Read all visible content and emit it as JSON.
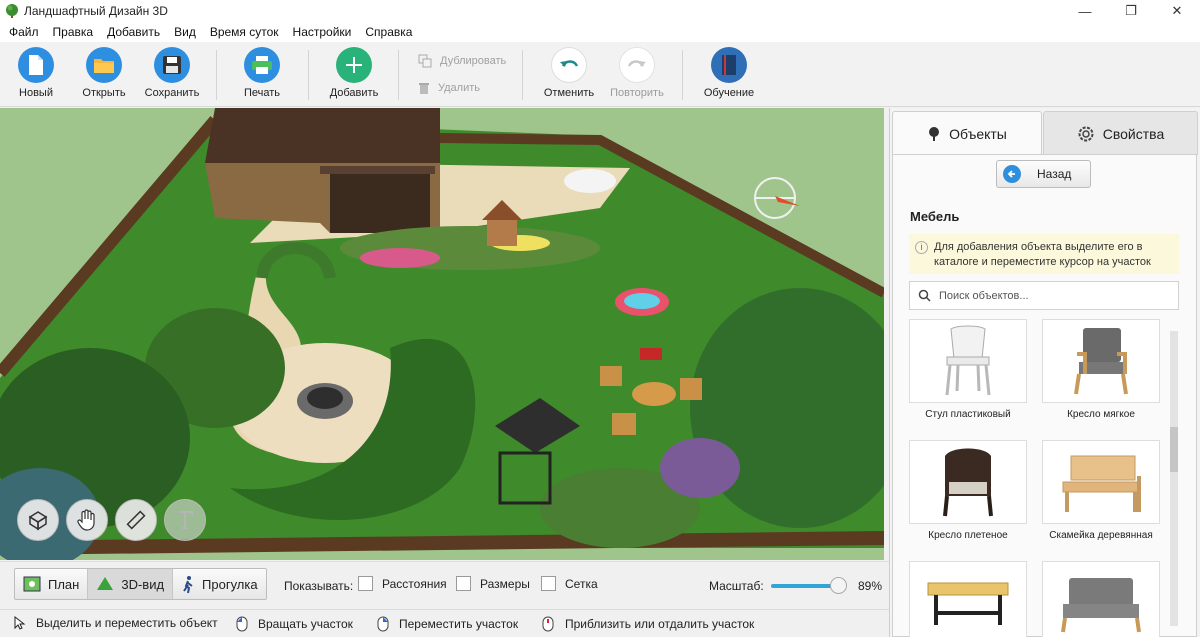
{
  "window": {
    "title": "Ландшафтный Дизайн 3D",
    "controls": [
      "—",
      "❐",
      "✕"
    ]
  },
  "menu": [
    "Файл",
    "Правка",
    "Добавить",
    "Вид",
    "Время суток",
    "Настройки",
    "Справка"
  ],
  "toolbar": {
    "new": "Новый",
    "open": "Открыть",
    "save": "Сохранить",
    "print": "Печать",
    "add": "Добавить",
    "duplicate": "Дублировать",
    "delete": "Удалить",
    "undo": "Отменить",
    "redo": "Повторить",
    "learn": "Обучение"
  },
  "view_tools": [
    "objects-tool-icon",
    "hand-pan-icon",
    "ruler-icon",
    "text-tool-icon"
  ],
  "panel": {
    "tabs": {
      "objects": "Объекты",
      "properties": "Свойства"
    },
    "back": "Назад",
    "section": "Мебель",
    "hint": "Для добавления объекта выделите его в каталоге и переместите курсор на участок",
    "search_placeholder": "Поиск объектов...",
    "items": [
      {
        "label": "Стул пластиковый"
      },
      {
        "label": "Кресло мягкое"
      },
      {
        "label": "Кресло плетеное"
      },
      {
        "label": "Скамейка деревянная"
      },
      {
        "label": ""
      },
      {
        "label": ""
      }
    ]
  },
  "viewbar": {
    "modes": {
      "plan": "План",
      "view3d": "3D-вид",
      "walk": "Прогулка"
    },
    "active_mode": "3D-вид",
    "show_label": "Показывать:",
    "checks": {
      "distances": "Расстояния",
      "sizes": "Размеры",
      "grid": "Сетка"
    },
    "zoom_label": "Масштаб:",
    "zoom_value": "89%",
    "zoom_fraction": 0.89
  },
  "status": {
    "select": "Выделить и переместить объект",
    "rotate": "Вращать участок",
    "move": "Переместить участок",
    "zoom": "Приблизить или отдалить участок"
  },
  "colors": {
    "accent": "#2f8fdc",
    "lawn": "#3f8a2a",
    "slider": "#30a5d6",
    "hint_bg": "#fbf8dc"
  }
}
